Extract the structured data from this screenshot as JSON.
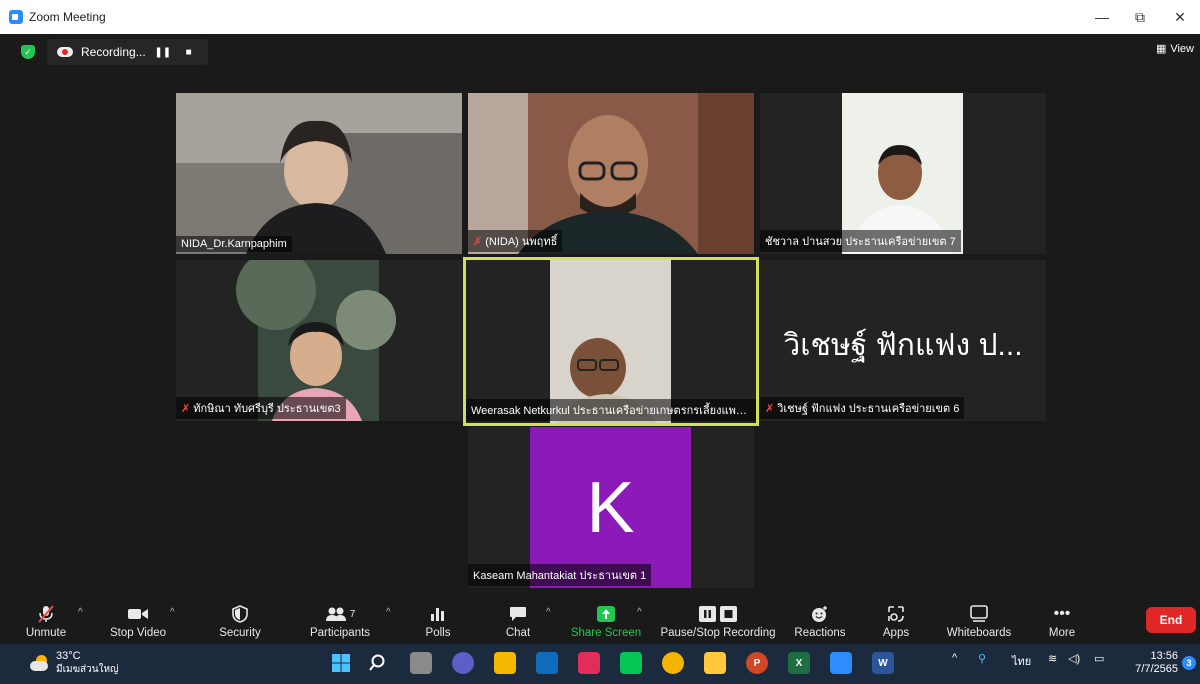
{
  "window": {
    "title": "Zoom Meeting",
    "minimize": "—",
    "restore": "⧉",
    "close": "✕"
  },
  "top": {
    "recording_label": "Recording...",
    "view_label": "View"
  },
  "tiles": [
    {
      "name": "NIDA_Dr.Karnpaphim"
    },
    {
      "name": "(NIDA) นพฤทธิ์"
    },
    {
      "name": "ชัชวาล ปานสวย ประธานเครือข่ายเขต 7"
    },
    {
      "name": "ทักษิณา ทับศรีบุรี ประธานเขต3"
    },
    {
      "name": "Weerasak Netkurkul ประธานเครือข่ายเกษตรกรเลี้ยงแพะแ..."
    },
    {
      "name": "วิเชษฐ์ ฟักแฟง ประธานเครือข่ายเขต 6",
      "big_name": "วิเชษฐ์ ฟักแฟง ป..."
    },
    {
      "name": "Kaseam Mahantakiat ประธานเขต 1",
      "avatar_letter": "K"
    }
  ],
  "toolbar": {
    "unmute": "Unmute",
    "stop_video": "Stop Video",
    "security": "Security",
    "participants": "Participants",
    "participants_count": "7",
    "polls": "Polls",
    "chat": "Chat",
    "share_screen": "Share Screen",
    "pause_recording": "Pause/Stop Recording",
    "reactions": "Reactions",
    "apps": "Apps",
    "whiteboards": "Whiteboards",
    "more": "More",
    "end": "End"
  },
  "taskbar": {
    "temp": "33°C",
    "weather_desc": "มีเมฆส่วนใหญ่",
    "lang": "ไทย",
    "time": "13:56",
    "date": "7/7/2565",
    "notifications": "3"
  },
  "colors": {
    "speaker_border": "#d4e157",
    "accent_green": "#23c552",
    "end_red": "#e02828",
    "avatar_purple": "#8c1ab8"
  }
}
